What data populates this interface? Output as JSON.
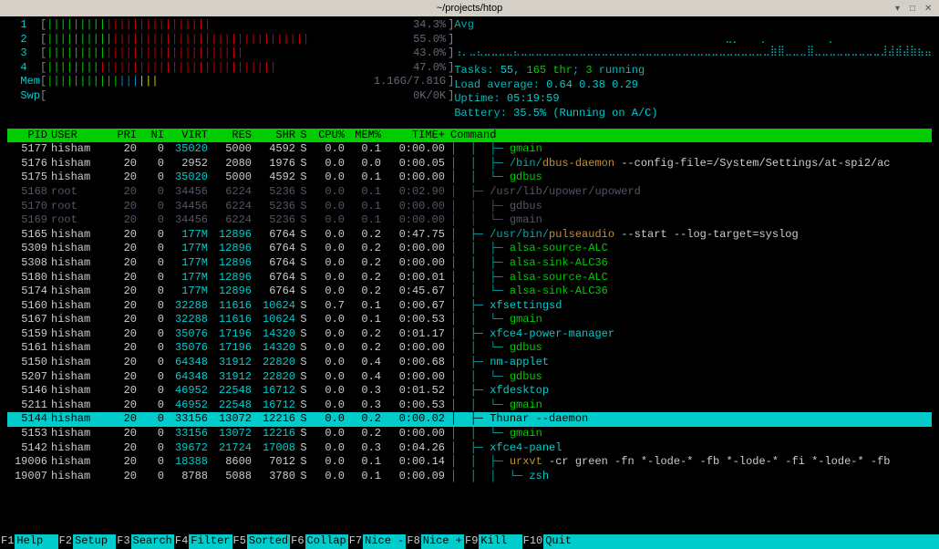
{
  "titlebar": {
    "path": "~/projects/htop"
  },
  "cpu_meters": [
    {
      "label": "1",
      "green": 9,
      "red": 16,
      "value": "34.3%"
    },
    {
      "label": "2",
      "green": 10,
      "red": 30,
      "value": "55.0%"
    },
    {
      "label": "3",
      "green": 9,
      "red": 21,
      "value": "43.0%"
    },
    {
      "label": "4",
      "green": 8,
      "red": 27,
      "value": "47.0%"
    }
  ],
  "mem": {
    "label": "Mem",
    "green": 11,
    "blue": 3,
    "yellow": 3,
    "value": "1.16G/7.81G"
  },
  "swp": {
    "label": "Swp",
    "value": "0K/0K"
  },
  "avg_label": "Avg",
  "graph_lines": [
    "                                             ⣀⡀   ⢀          ⢀",
    "⢠⡀⣀⣄⣀⣀⣀⣀⣄⣀⣀⣀⣀⣀⣀⣀⣀⣀⣀⣀⣀⣀⣀⣀⣀⣀⣀⣀⣀⣀⣀⣀⣀⣀⣀⣀⣀⣀⣀⣀⣀⣀⣀⣷⣿⣀⣀⣀⣿⣀⣀⣀⣀⣀⣀⣀⣀⣀⣸⣼⣾⣼⣷⣦⣤"
  ],
  "tasks_line": {
    "prefix": "Tasks: ",
    "tasks": "55",
    "mid": ", ",
    "thr": "165 thr",
    "sep": "; ",
    "running": "3",
    "suffix": " running"
  },
  "load": {
    "label": "Load average: ",
    "v1": "0.64",
    "v2": "0.38",
    "v3": "0.29"
  },
  "uptime": {
    "label": "Uptime: ",
    "value": "05:19:59"
  },
  "battery": {
    "label": "Battery: ",
    "value": "35.5% (Running on A/C)"
  },
  "headers": [
    "PID",
    "USER",
    "PRI",
    "NI",
    "VIRT",
    "RES",
    "SHR",
    "S",
    "CPU%",
    "MEM%",
    "TIME+",
    "Command"
  ],
  "processes": [
    {
      "pid": "5177",
      "user": "hisham",
      "pri": "20",
      "ni": "0",
      "virt": "35020",
      "virt_hi": true,
      "res": "5000",
      "shr": "4592",
      "s": "S",
      "cpu": "0.0",
      "mem": "0.1",
      "time": "0:00.00",
      "tree": "│  │  ├─ ",
      "cmd": "gmain",
      "style": "thread"
    },
    {
      "pid": "5176",
      "user": "hisham",
      "pri": "20",
      "ni": "0",
      "virt": "2952",
      "res": "2080",
      "shr": "1976",
      "s": "S",
      "cpu": "0.0",
      "mem": "0.0",
      "time": "0:00.05",
      "tree": "│  │  ├─ ",
      "path": "/bin/",
      "base": "dbus-daemon",
      "args": " --config-file=/System/Settings/at-spi2/ac",
      "style": "cmd"
    },
    {
      "pid": "5175",
      "user": "hisham",
      "pri": "20",
      "ni": "0",
      "virt": "35020",
      "virt_hi": true,
      "res": "5000",
      "shr": "4592",
      "s": "S",
      "cpu": "0.0",
      "mem": "0.1",
      "time": "0:00.00",
      "tree": "│  │  └─ ",
      "cmd": "gdbus",
      "style": "thread"
    },
    {
      "pid": "5168",
      "user": "root",
      "pri": "20",
      "ni": "0",
      "virt": "34456",
      "res": "6224",
      "shr": "5236",
      "s": "S",
      "cpu": "0.0",
      "mem": "0.1",
      "time": "0:02.90",
      "tree": "│  ├─ ",
      "path": "/usr/lib/upower/",
      "base": "upowerd",
      "style": "dim"
    },
    {
      "pid": "5170",
      "user": "root",
      "pri": "20",
      "ni": "0",
      "virt": "34456",
      "res": "6224",
      "shr": "5236",
      "s": "S",
      "cpu": "0.0",
      "mem": "0.1",
      "time": "0:00.00",
      "tree": "│  │  ├─ ",
      "cmd": "gdbus",
      "style": "dim"
    },
    {
      "pid": "5169",
      "user": "root",
      "pri": "20",
      "ni": "0",
      "virt": "34456",
      "res": "6224",
      "shr": "5236",
      "s": "S",
      "cpu": "0.0",
      "mem": "0.1",
      "time": "0:00.00",
      "tree": "│  │  └─ ",
      "cmd": "gmain",
      "style": "dim"
    },
    {
      "pid": "5165",
      "user": "hisham",
      "pri": "20",
      "ni": "0",
      "virt": "177M",
      "virt_hi": true,
      "res": "12896",
      "res_hi": true,
      "shr": "6764",
      "s": "S",
      "cpu": "0.0",
      "mem": "0.2",
      "time": "0:47.75",
      "tree": "│  ├─ ",
      "path": "/usr/bin/",
      "base": "pulseaudio",
      "args": " --start --log-target=syslog",
      "style": "cmd"
    },
    {
      "pid": "5309",
      "user": "hisham",
      "pri": "20",
      "ni": "0",
      "virt": "177M",
      "virt_hi": true,
      "res": "12896",
      "res_hi": true,
      "shr": "6764",
      "s": "S",
      "cpu": "0.0",
      "mem": "0.2",
      "time": "0:00.00",
      "tree": "│  │  ├─ ",
      "cmd": "alsa-source-ALC",
      "style": "thread"
    },
    {
      "pid": "5308",
      "user": "hisham",
      "pri": "20",
      "ni": "0",
      "virt": "177M",
      "virt_hi": true,
      "res": "12896",
      "res_hi": true,
      "shr": "6764",
      "s": "S",
      "cpu": "0.0",
      "mem": "0.2",
      "time": "0:00.00",
      "tree": "│  │  ├─ ",
      "cmd": "alsa-sink-ALC36",
      "style": "thread"
    },
    {
      "pid": "5180",
      "user": "hisham",
      "pri": "20",
      "ni": "0",
      "virt": "177M",
      "virt_hi": true,
      "res": "12896",
      "res_hi": true,
      "shr": "6764",
      "s": "S",
      "cpu": "0.0",
      "mem": "0.2",
      "time": "0:00.01",
      "tree": "│  │  ├─ ",
      "cmd": "alsa-source-ALC",
      "style": "thread"
    },
    {
      "pid": "5174",
      "user": "hisham",
      "pri": "20",
      "ni": "0",
      "virt": "177M",
      "virt_hi": true,
      "res": "12896",
      "res_hi": true,
      "shr": "6764",
      "s": "S",
      "cpu": "0.0",
      "mem": "0.2",
      "time": "0:45.67",
      "tree": "│  │  └─ ",
      "cmd": "alsa-sink-ALC36",
      "style": "thread"
    },
    {
      "pid": "5160",
      "user": "hisham",
      "pri": "20",
      "ni": "0",
      "virt": "32288",
      "virt_hi": true,
      "res": "11616",
      "res_hi": true,
      "shr": "10624",
      "shr_hi": true,
      "s": "S",
      "cpu": "0.7",
      "mem": "0.1",
      "time": "0:00.67",
      "tree": "│  ├─ ",
      "cmd": "xfsettingsd",
      "style": "maincmd"
    },
    {
      "pid": "5167",
      "user": "hisham",
      "pri": "20",
      "ni": "0",
      "virt": "32288",
      "virt_hi": true,
      "res": "11616",
      "res_hi": true,
      "shr": "10624",
      "shr_hi": true,
      "s": "S",
      "cpu": "0.0",
      "mem": "0.1",
      "time": "0:00.53",
      "tree": "│  │  └─ ",
      "cmd": "gmain",
      "style": "thread"
    },
    {
      "pid": "5159",
      "user": "hisham",
      "pri": "20",
      "ni": "0",
      "virt": "35076",
      "virt_hi": true,
      "res": "17196",
      "res_hi": true,
      "shr": "14320",
      "shr_hi": true,
      "s": "S",
      "cpu": "0.0",
      "mem": "0.2",
      "time": "0:01.17",
      "tree": "│  ├─ ",
      "cmd": "xfce4-power-manager",
      "style": "maincmd"
    },
    {
      "pid": "5161",
      "user": "hisham",
      "pri": "20",
      "ni": "0",
      "virt": "35076",
      "virt_hi": true,
      "res": "17196",
      "res_hi": true,
      "shr": "14320",
      "shr_hi": true,
      "s": "S",
      "cpu": "0.0",
      "mem": "0.2",
      "time": "0:00.00",
      "tree": "│  │  └─ ",
      "cmd": "gdbus",
      "style": "thread"
    },
    {
      "pid": "5150",
      "user": "hisham",
      "pri": "20",
      "ni": "0",
      "virt": "64348",
      "virt_hi": true,
      "res": "31912",
      "res_hi": true,
      "shr": "22820",
      "shr_hi": true,
      "s": "S",
      "cpu": "0.0",
      "mem": "0.4",
      "time": "0:00.68",
      "tree": "│  ├─ ",
      "cmd": "nm-applet",
      "style": "maincmd"
    },
    {
      "pid": "5207",
      "user": "hisham",
      "pri": "20",
      "ni": "0",
      "virt": "64348",
      "virt_hi": true,
      "res": "31912",
      "res_hi": true,
      "shr": "22820",
      "shr_hi": true,
      "s": "S",
      "cpu": "0.0",
      "mem": "0.4",
      "time": "0:00.00",
      "tree": "│  │  └─ ",
      "cmd": "gdbus",
      "style": "thread"
    },
    {
      "pid": "5146",
      "user": "hisham",
      "pri": "20",
      "ni": "0",
      "virt": "46952",
      "virt_hi": true,
      "res": "22548",
      "res_hi": true,
      "shr": "16712",
      "shr_hi": true,
      "s": "S",
      "cpu": "0.0",
      "mem": "0.3",
      "time": "0:01.52",
      "tree": "│  ├─ ",
      "cmd": "xfdesktop",
      "style": "maincmd"
    },
    {
      "pid": "5211",
      "user": "hisham",
      "pri": "20",
      "ni": "0",
      "virt": "46952",
      "virt_hi": true,
      "res": "22548",
      "res_hi": true,
      "shr": "16712",
      "shr_hi": true,
      "s": "S",
      "cpu": "0.0",
      "mem": "0.3",
      "time": "0:00.53",
      "tree": "│  │  └─ ",
      "cmd": "gmain",
      "style": "thread"
    },
    {
      "pid": "5144",
      "user": "hisham",
      "pri": "20",
      "ni": "0",
      "virt": "33156",
      "res": "13072",
      "shr": "12216",
      "s": "S",
      "cpu": "0.0",
      "mem": "0.2",
      "time": "0:00.02",
      "tree": "│  ├─ ",
      "base": "Thunar",
      "args": " --daemon",
      "style": "selected"
    },
    {
      "pid": "5153",
      "user": "hisham",
      "pri": "20",
      "ni": "0",
      "virt": "33156",
      "virt_hi": true,
      "res": "13072",
      "res_hi": true,
      "shr": "12216",
      "shr_hi": true,
      "s": "S",
      "cpu": "0.0",
      "mem": "0.2",
      "time": "0:00.00",
      "tree": "│  │  └─ ",
      "cmd": "gmain",
      "style": "thread"
    },
    {
      "pid": "5142",
      "user": "hisham",
      "pri": "20",
      "ni": "0",
      "virt": "39672",
      "virt_hi": true,
      "res": "21724",
      "res_hi": true,
      "shr": "17008",
      "shr_hi": true,
      "s": "S",
      "cpu": "0.0",
      "mem": "0.3",
      "time": "0:04.26",
      "tree": "│  ├─ ",
      "cmd": "xfce4-panel",
      "style": "maincmd"
    },
    {
      "pid": "19006",
      "user": "hisham",
      "pri": "20",
      "ni": "0",
      "virt": "18388",
      "virt_hi": true,
      "res": "8600",
      "shr": "7012",
      "s": "S",
      "cpu": "0.0",
      "mem": "0.1",
      "time": "0:00.14",
      "tree": "│  │  ├─ ",
      "base": "urxvt",
      "args": " -cr green -fn *-lode-* -fb *-lode-* -fi *-lode-* -fb",
      "style": "cmd"
    },
    {
      "pid": "19007",
      "user": "hisham",
      "pri": "20",
      "ni": "0",
      "virt": "8788",
      "res": "5088",
      "shr": "3780",
      "s": "S",
      "cpu": "0.0",
      "mem": "0.1",
      "time": "0:00.09",
      "tree": "│  │  │  └─ ",
      "cmd": "zsh",
      "style": "maincmd"
    }
  ],
  "footer": [
    {
      "key": "F1",
      "label": "Help  "
    },
    {
      "key": "F2",
      "label": "Setup "
    },
    {
      "key": "F3",
      "label": "Search"
    },
    {
      "key": "F4",
      "label": "Filter"
    },
    {
      "key": "F5",
      "label": "Sorted"
    },
    {
      "key": "F6",
      "label": "Collap"
    },
    {
      "key": "F7",
      "label": "Nice -"
    },
    {
      "key": "F8",
      "label": "Nice +"
    },
    {
      "key": "F9",
      "label": "Kill  "
    },
    {
      "key": "F10",
      "label": "Quit  "
    }
  ]
}
